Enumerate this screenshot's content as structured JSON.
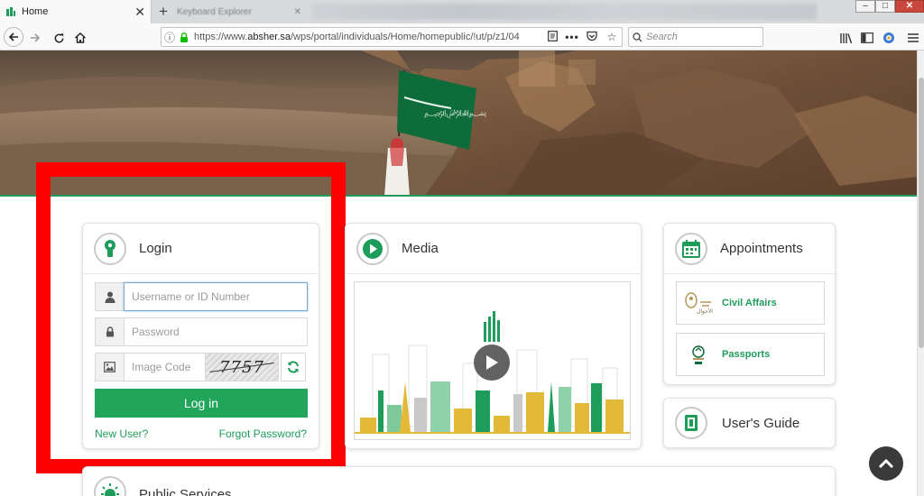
{
  "browser": {
    "active_tab_title": "Home",
    "background_tab_title": "Keyboard Explorer",
    "url_scheme_host": "https://www.",
    "url_domain": "absher.sa",
    "url_path": "/wps/portal/individuals/Home/homepublic/!ut/p/z1/04",
    "search_placeholder": "Search",
    "window_controls": {
      "minimize": "–",
      "maximize": "□",
      "close": "✕"
    },
    "icons": [
      "back-icon",
      "forward-icon",
      "reload-icon",
      "home-icon",
      "info-icon",
      "lock-icon",
      "reader-view-icon",
      "more-icon",
      "pocket-icon",
      "bookmark-star-icon",
      "search-icon",
      "library-icon",
      "sidebar-icon",
      "extension-icon",
      "menu-icon"
    ],
    "colors": {
      "tabbar": "#d8dadd",
      "toolbar": "#f9f9fa",
      "lock": "#12bc00"
    }
  },
  "hero": {
    "description_icon": "flag-landscape-banner",
    "accent_line_color": "#1e9c5a"
  },
  "login": {
    "title": "Login",
    "username_placeholder": "Username or ID Number",
    "password_placeholder": "Password",
    "image_code_placeholder": "Image Code",
    "captcha_text": "7757",
    "button_label": "Log in",
    "new_user_link": "New User?",
    "forgot_password_link": "Forgot Password?",
    "icons": [
      "keyhole-icon",
      "user-icon",
      "lock-icon",
      "image-icon",
      "refresh-icon"
    ],
    "accent_color": "#21a55b",
    "annotation_highlight_color": "#ff0000"
  },
  "media": {
    "title": "Media",
    "icons": [
      "play-circle-icon",
      "play-icon"
    ]
  },
  "appointments": {
    "title": "Appointments",
    "items": [
      {
        "label": "Civil Affairs",
        "icon": "civil-affairs-emblem-icon"
      },
      {
        "label": "Passports",
        "icon": "passports-emblem-icon"
      }
    ]
  },
  "user_guide": {
    "title": "User's Guide",
    "icon": "book-icon"
  },
  "public_services": {
    "title": "Public Services",
    "icon": "sun-icon"
  },
  "scroll_top": {
    "icon": "chevron-up-icon"
  }
}
